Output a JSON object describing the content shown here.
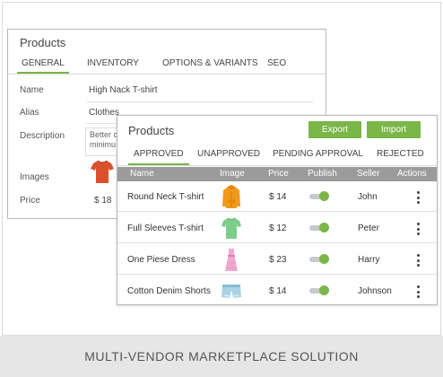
{
  "back_card": {
    "title": "Products",
    "tabs": [
      "GENERAL",
      "INVENTORY",
      "OPTIONS & VARIANTS",
      "SEO"
    ],
    "fields": {
      "name_label": "Name",
      "name_value": "High Nack T-shirt",
      "alias_label": "Alias",
      "alias_value": "Clothes",
      "description_label": "Description",
      "description_value": "Better c minimu",
      "images_label": "Images",
      "price_label": "Price",
      "price_value": "$ 18"
    }
  },
  "front_card": {
    "title": "Products",
    "export_label": "Export",
    "import_label": "Import",
    "tabs": [
      "APPROVED",
      "UNAPPROVED",
      "PENDING APPROVAL",
      "REJECTED"
    ],
    "columns": [
      "Name",
      "Image",
      "Price",
      "Publish",
      "Seller",
      "Actions"
    ],
    "rows": [
      {
        "name": "Round Neck T-shirt",
        "price": "$ 14",
        "seller": "John",
        "image_icon": "orange-hoodie-icon",
        "published": true
      },
      {
        "name": "Full Sleeves T-shirt",
        "price": "$ 12",
        "seller": "Peter",
        "image_icon": "green-tshirt-icon",
        "published": true
      },
      {
        "name": "One Piese Dress",
        "price": "$ 23",
        "seller": "Harry",
        "image_icon": "pink-dress-icon",
        "published": true
      },
      {
        "name": "Cotton Denim Shorts",
        "price": "$ 14",
        "seller": "Johnson",
        "image_icon": "denim-shorts-icon",
        "published": true
      }
    ]
  },
  "footer": {
    "text": "MULTI-VENDOR MARKETPLACE SOLUTION"
  },
  "colors": {
    "accent": "#7ab648",
    "header_gray": "#9b9b9b",
    "footer_bg": "#e6e6e6"
  }
}
